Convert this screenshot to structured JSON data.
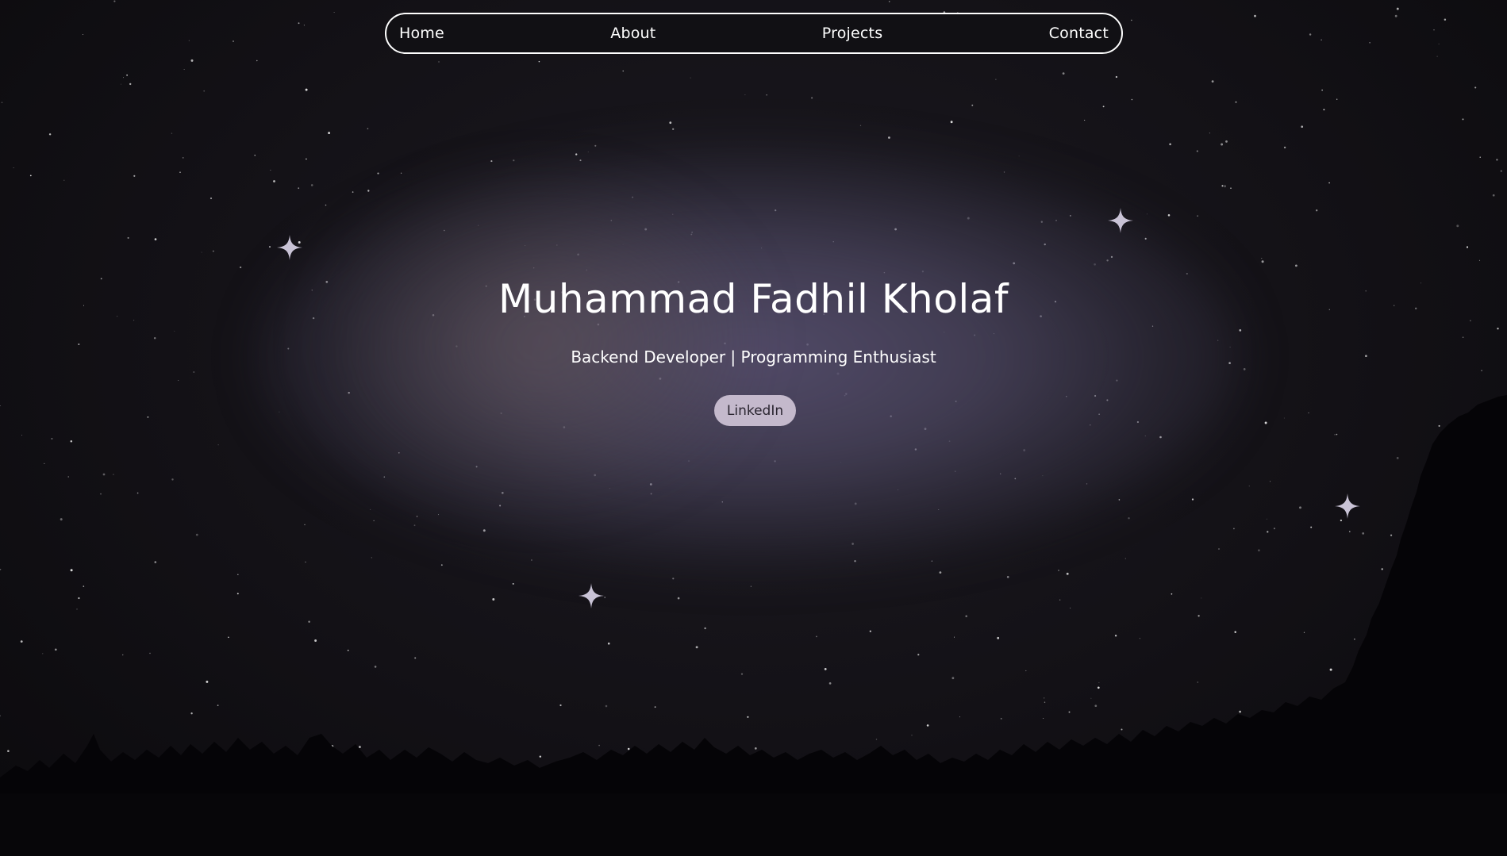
{
  "nav": {
    "items": [
      {
        "label": "Home"
      },
      {
        "label": "About"
      },
      {
        "label": "Projects"
      },
      {
        "label": "Contact"
      }
    ]
  },
  "hero": {
    "title": "Muhammad Fadhil Kholaf",
    "subtitle": "Backend Developer | Programming Enthusiast",
    "cta_label": "LinkedIn"
  },
  "decor": {
    "sparkle_icon": "four-point-star-icon",
    "sparkle_color": "#c9c3d6",
    "accent_button_color": "#c4b9cc",
    "background_color": "#0b0a0d"
  }
}
